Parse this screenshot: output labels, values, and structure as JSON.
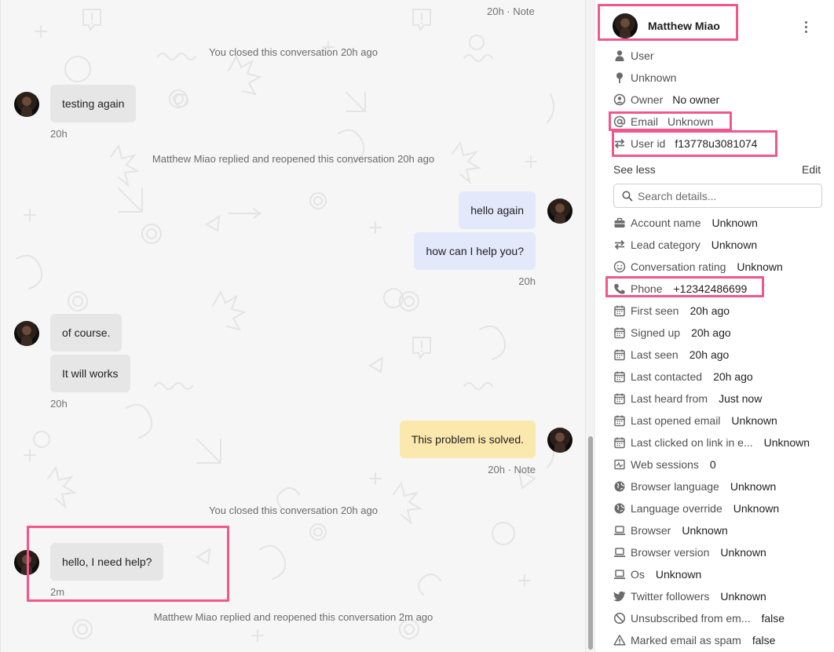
{
  "conversation": {
    "top_meta": "20h · Note",
    "events": {
      "closed_1": "You closed this conversation 20h ago",
      "reopened_1": "Matthew Miao replied and reopened this conversation 20h ago",
      "closed_2": "You closed this conversation 20h ago",
      "reopened_2": "Matthew Miao replied and reopened this conversation 2m ago"
    },
    "messages": {
      "m1": "testing again",
      "m1_time": "20h",
      "m2": "hello again",
      "m3": "how can I help you?",
      "m3_time": "20h",
      "m4": "of course.",
      "m5": "It will works",
      "m5_time": "20h",
      "m6": "This problem is solved.",
      "m6_meta": "20h · Note",
      "m7": "hello, I need help?",
      "m7_time": "2m"
    },
    "colors": {
      "incoming_bubble": "#e6e6e6",
      "outgoing_bubble": "#e3e8fb",
      "note_bubble": "#fbe8ad",
      "highlight": "#f0578d"
    }
  },
  "details": {
    "name": "Matthew Miao",
    "more_icon": "vertical-ellipsis-icon",
    "summary": [
      {
        "name": "type",
        "icon": "person-icon",
        "label": "User",
        "value": ""
      },
      {
        "name": "location",
        "icon": "location-pin-icon",
        "label": "Unknown",
        "value": ""
      },
      {
        "name": "owner",
        "icon": "owner-icon",
        "label": "Owner",
        "value": "No owner"
      },
      {
        "name": "email",
        "icon": "at-sign-icon",
        "label": "Email",
        "value": "Unknown"
      },
      {
        "name": "user-id",
        "icon": "swap-arrows-icon",
        "label": "User id",
        "value": "f13778u3081074"
      }
    ],
    "see_less": "See less",
    "edit": "Edit",
    "search_placeholder": "Search details...",
    "attributes": [
      {
        "name": "account-name",
        "icon": "briefcase-icon",
        "label": "Account name",
        "value": "Unknown"
      },
      {
        "name": "lead-category",
        "icon": "swap-arrows-icon",
        "label": "Lead category",
        "value": "Unknown"
      },
      {
        "name": "conversation-rating",
        "icon": "smiley-icon",
        "label": "Conversation rating",
        "value": "Unknown"
      },
      {
        "name": "phone",
        "icon": "phone-icon",
        "label": "Phone",
        "value": "+12342486699"
      },
      {
        "name": "first-seen",
        "icon": "calendar-icon",
        "label": "First seen",
        "value": "20h ago"
      },
      {
        "name": "signed-up",
        "icon": "calendar-icon",
        "label": "Signed up",
        "value": "20h ago"
      },
      {
        "name": "last-seen",
        "icon": "calendar-icon",
        "label": "Last seen",
        "value": "20h ago"
      },
      {
        "name": "last-contacted",
        "icon": "calendar-icon",
        "label": "Last contacted",
        "value": "20h ago"
      },
      {
        "name": "last-heard-from",
        "icon": "calendar-icon",
        "label": "Last heard from",
        "value": "Just now"
      },
      {
        "name": "last-opened-email",
        "icon": "calendar-icon",
        "label": "Last opened email",
        "value": "Unknown"
      },
      {
        "name": "last-clicked-link",
        "icon": "calendar-icon",
        "label": "Last clicked on link in e...",
        "value": "Unknown"
      },
      {
        "name": "web-sessions",
        "icon": "activity-chart-icon",
        "label": "Web sessions",
        "value": "0"
      },
      {
        "name": "browser-language",
        "icon": "globe-icon",
        "label": "Browser language",
        "value": "Unknown"
      },
      {
        "name": "language-override",
        "icon": "globe-icon",
        "label": "Language override",
        "value": "Unknown"
      },
      {
        "name": "browser",
        "icon": "laptop-icon",
        "label": "Browser",
        "value": "Unknown"
      },
      {
        "name": "browser-version",
        "icon": "laptop-icon",
        "label": "Browser version",
        "value": "Unknown"
      },
      {
        "name": "os",
        "icon": "laptop-icon",
        "label": "Os",
        "value": "Unknown"
      },
      {
        "name": "twitter-followers",
        "icon": "twitter-bird-icon",
        "label": "Twitter followers",
        "value": "Unknown"
      },
      {
        "name": "unsubscribed",
        "icon": "block-icon",
        "label": "Unsubscribed from em...",
        "value": "false"
      },
      {
        "name": "marked-spam",
        "icon": "warning-icon",
        "label": "Marked email as spam",
        "value": "false"
      }
    ]
  }
}
